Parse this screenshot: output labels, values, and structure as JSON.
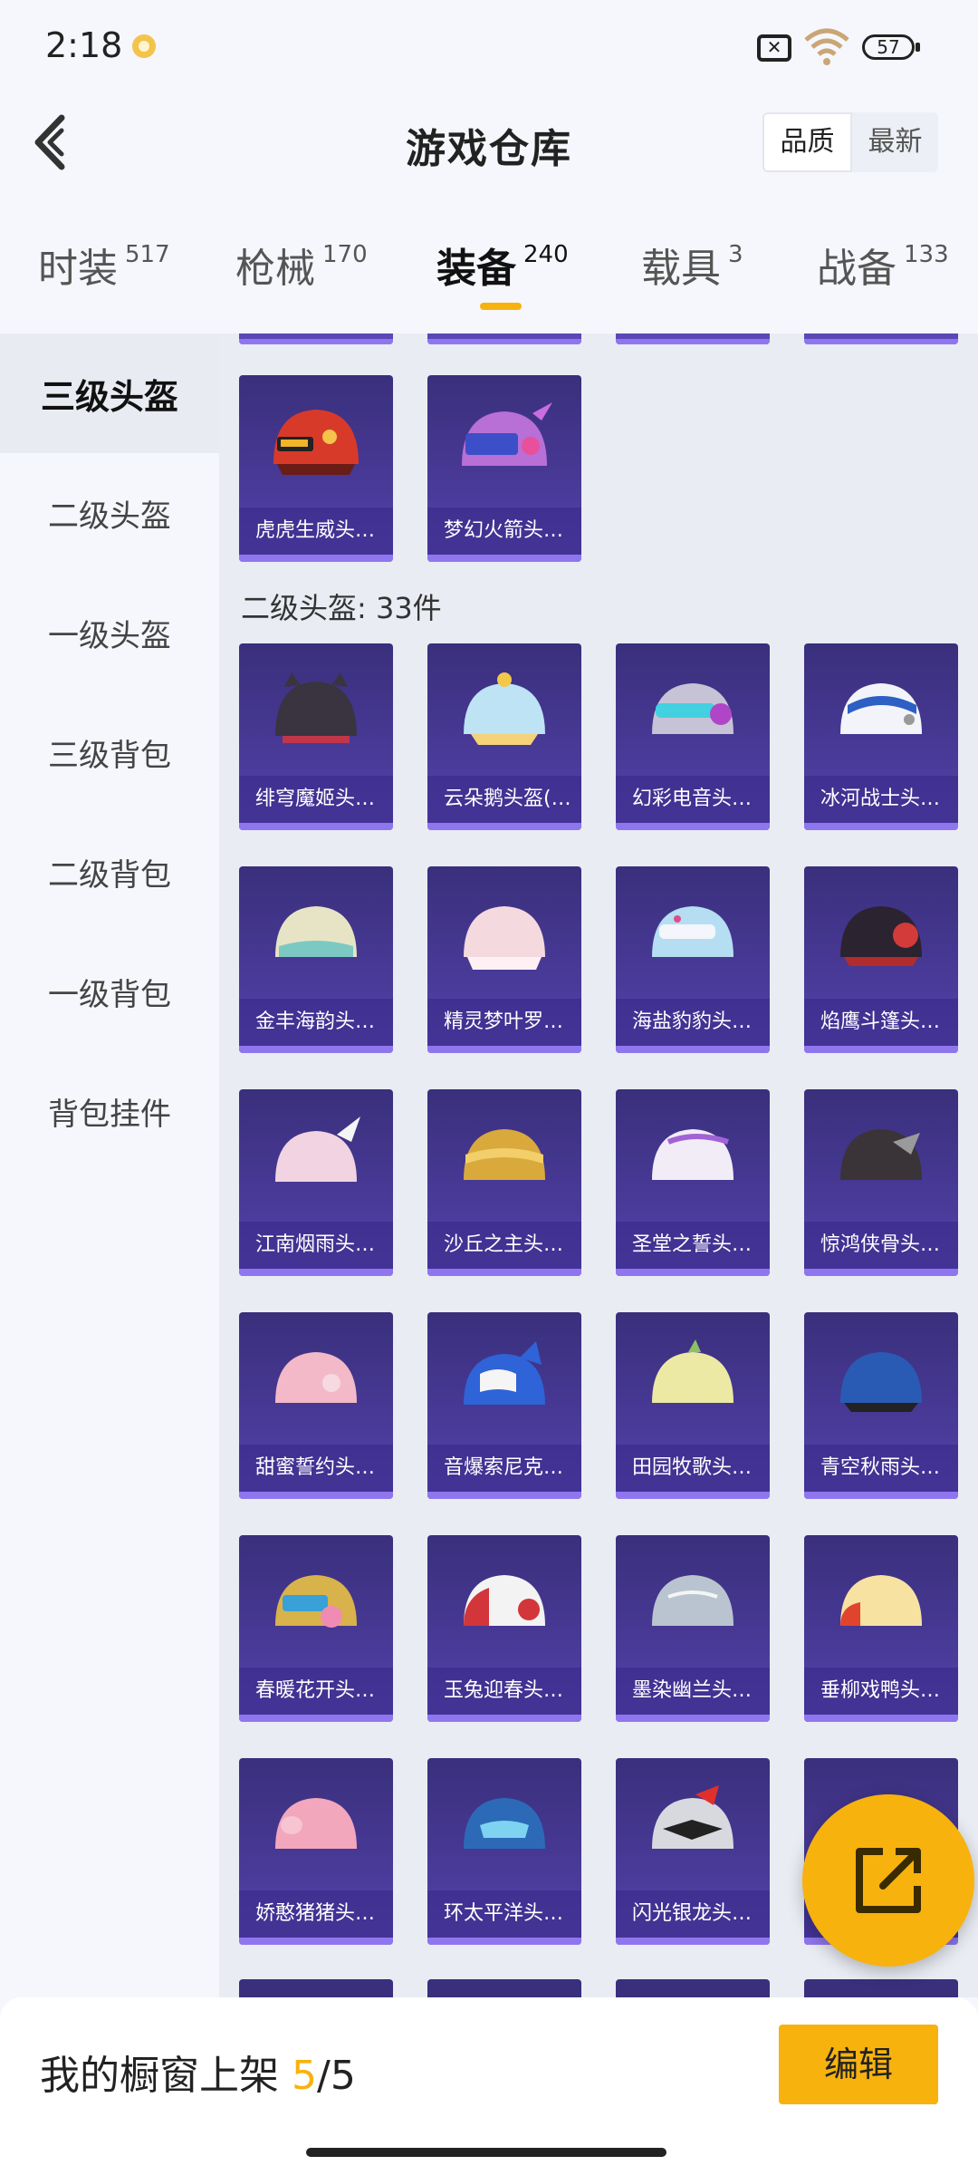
{
  "status": {
    "time": "2:18",
    "battery": "57",
    "signal_glyph": "✕"
  },
  "header": {
    "title": "游戏仓库",
    "sort_options": [
      "品质",
      "最新"
    ]
  },
  "tabs": [
    {
      "label": "时装",
      "count": "517"
    },
    {
      "label": "枪械",
      "count": "170"
    },
    {
      "label": "装备",
      "count": "240"
    },
    {
      "label": "载具",
      "count": "3"
    },
    {
      "label": "战备",
      "count": "133"
    }
  ],
  "sidebar": {
    "items": [
      "三级头盔",
      "二级头盔",
      "一级头盔",
      "三级背包",
      "二级背包",
      "一级背包",
      "背包挂件"
    ]
  },
  "content": {
    "level3_items": [
      "虎虎生威头…",
      "梦幻火箭头…"
    ],
    "section_title": "二级头盔: 33件",
    "level2_items": [
      "绯穹魔姬头…",
      "云朵鹅头盔(…",
      "幻彩电音头…",
      "冰河战士头…",
      "金丰海韵头…",
      "精灵梦叶罗…",
      "海盐豹豹头…",
      "焰鹰斗篷头…",
      "江南烟雨头…",
      "沙丘之主头…",
      "圣堂之誓头…",
      "惊鸿侠骨头…",
      "甜蜜誓约头…",
      "音爆索尼克…",
      "田园牧歌头…",
      "青空秋雨头…",
      "春暖花开头…",
      "玉兔迎春头…",
      "墨染幽兰头…",
      "垂柳戏鸭头…",
      "娇憨猪猪头…",
      "环太平洋头…",
      "闪光银龙头…",
      "…"
    ]
  },
  "bottom": {
    "label": "我的橱窗上架",
    "count": "5",
    "slash": "/",
    "max": "5",
    "edit_label": "编辑"
  },
  "colors": {
    "accent": "#f7b20e",
    "tile": "#4a3b9a"
  }
}
